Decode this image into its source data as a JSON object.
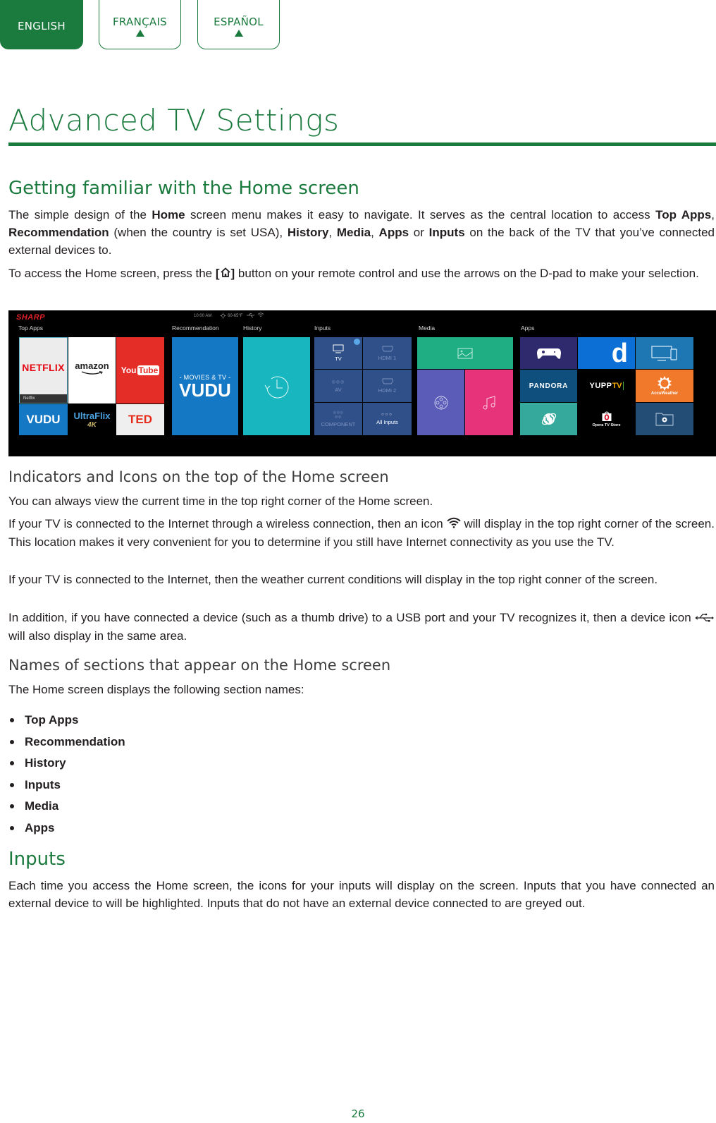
{
  "language_tabs": [
    {
      "label": "ENGLISH",
      "active": true
    },
    {
      "label": "FRANÇAIS",
      "active": false
    },
    {
      "label": "ESPAÑOL",
      "active": false
    }
  ],
  "page_title": "Advanced TV Settings",
  "section1": {
    "heading": "Getting familiar with the Home screen",
    "p1": {
      "t1": "The simple design of the ",
      "b1": "Home",
      "t2": " screen menu makes it easy to navigate. It serves as the central location to access ",
      "b2": "Top Apps",
      "t3": ", ",
      "b3": "Recommendation",
      "t4": " (when the country is set USA), ",
      "b4": "History",
      "t5": ", ",
      "b5": "Media",
      "t6": ", ",
      "b6": "Apps",
      "t7": " or ",
      "b7": "Inputs",
      "t8": " on the back of the TV that you’ve connected external devices to."
    },
    "p2": {
      "t1": "To access the Home screen, press the ",
      "b1_open": "[",
      "b1_close": "]",
      "t2": " button on your remote control and use the arrows on the D-pad to make your selection."
    }
  },
  "tv_screen": {
    "brand": "SHARP",
    "time": "10:00 AM",
    "weather": "60-65°F",
    "sections": {
      "top_apps": "Top Apps",
      "recommendation": "Recommendation",
      "history": "History",
      "inputs": "Inputs",
      "media": "Media",
      "apps": "Apps"
    },
    "top_apps": {
      "netflix": "NETFLIX",
      "netflix_caption": "Netflix",
      "amazon": "amazon",
      "youtube_you": "You",
      "youtube_tube": "Tube",
      "vudu": "VUDU",
      "ultraflix": "UltraFlix",
      "ultraflix_4k": "4K",
      "ted": "TED"
    },
    "recommendation": {
      "line1": "- MOVIES & TV -",
      "line2": "VUDU"
    },
    "inputs": [
      {
        "label": "TV",
        "active": true
      },
      {
        "label": "HDMI 1",
        "active": false
      },
      {
        "label": "AV",
        "active": false
      },
      {
        "label": "HDMI 2",
        "active": false
      },
      {
        "label": "COMPONENT",
        "active": false
      },
      {
        "label": "All Inputs",
        "active": true
      }
    ],
    "apps": {
      "pandora": "PANDORA",
      "yupp": "YUPP",
      "yupp_tv": "TV",
      "dailymotion": "d",
      "accuweather": "AccuWeather",
      "opera": "Opera TV Store"
    }
  },
  "section2": {
    "heading": "Indicators and Icons on the top of the Home screen",
    "p1": "You can always view the current time in the top right corner of the Home screen.",
    "p2_a": "If your TV is connected to the Internet through a wireless connection, then an icon ",
    "p2_b": " will display in the top right corner of the screen. This location makes it very convenient for you to determine if you still have Internet connectivity as you use the TV.",
    "p3": "If your TV is connected to the Internet, then the weather current conditions will display in the top right conner of the screen.",
    "p4_a": "In addition, if you have connected a device (such as a thumb drive) to a USB port and your TV recognizes it, then a device icon ",
    "p4_b": " will also display in the same area."
  },
  "section3": {
    "heading": "Names of sections that appear on the Home screen",
    "intro": "The Home screen displays the following section names:",
    "items": [
      "Top Apps",
      "Recommendation",
      "History",
      "Inputs",
      "Media",
      "Apps"
    ]
  },
  "section4": {
    "heading": "Inputs",
    "p1": "Each time you access the Home screen, the icons for your inputs will display on the screen. Inputs that you have connected an external device to will be highlighted. Inputs that do not have an external device connected to are greyed out."
  },
  "colors": {
    "brand_green": "#1b7a3e"
  },
  "page_number": "26"
}
